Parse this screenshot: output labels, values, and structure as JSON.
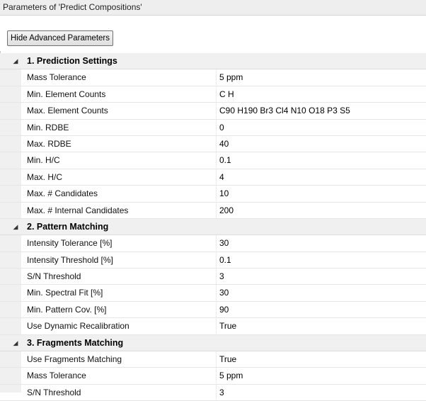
{
  "window": {
    "title": "Parameters of 'Predict Compositions'"
  },
  "toolbar": {
    "advanced_button_label": "Hide Advanced Parameters"
  },
  "grid": {
    "categories": [
      {
        "label": "1. Prediction Settings",
        "expander": "◢",
        "rows": [
          {
            "name": "Mass Tolerance",
            "value": "5 ppm"
          },
          {
            "name": "Min. Element Counts",
            "value": "C H"
          },
          {
            "name": "Max. Element Counts",
            "value": "C90 H190 Br3 Cl4 N10 O18 P3 S5"
          },
          {
            "name": "Min. RDBE",
            "value": "0"
          },
          {
            "name": "Max. RDBE",
            "value": "40"
          },
          {
            "name": "Min. H/C",
            "value": "0.1"
          },
          {
            "name": "Max. H/C",
            "value": "4"
          },
          {
            "name": "Max. # Candidates",
            "value": "10"
          },
          {
            "name": "Max. # Internal Candidates",
            "value": "200"
          }
        ]
      },
      {
        "label": "2. Pattern Matching",
        "expander": "◢",
        "rows": [
          {
            "name": "Intensity Tolerance [%]",
            "value": "30"
          },
          {
            "name": "Intensity Threshold [%]",
            "value": "0.1"
          },
          {
            "name": "S/N Threshold",
            "value": "3"
          },
          {
            "name": "Min. Spectral Fit [%]",
            "value": "30"
          },
          {
            "name": "Min. Pattern Cov. [%]",
            "value": "90"
          },
          {
            "name": "Use Dynamic Recalibration",
            "value": "True"
          }
        ]
      },
      {
        "label": "3. Fragments Matching",
        "expander": "◢",
        "rows": [
          {
            "name": "Use Fragments Matching",
            "value": "True"
          },
          {
            "name": "Mass Tolerance",
            "value": "5 ppm"
          },
          {
            "name": "S/N Threshold",
            "value": "3"
          }
        ]
      }
    ]
  }
}
